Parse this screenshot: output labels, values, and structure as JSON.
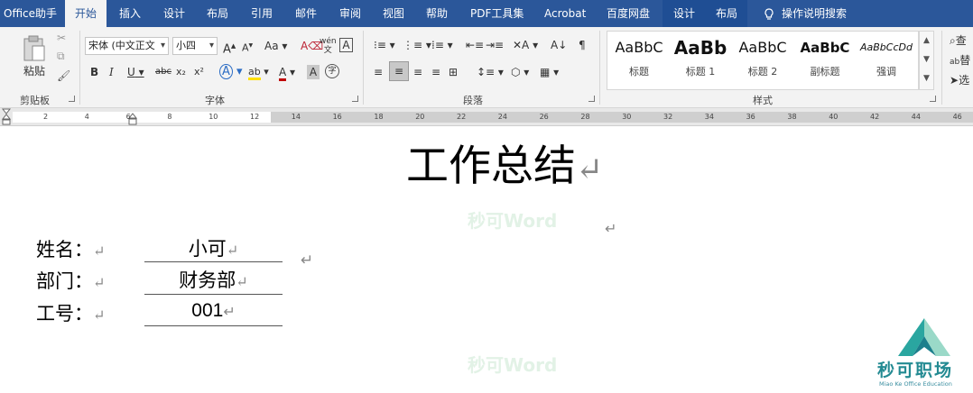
{
  "tabs": [
    {
      "label": "Office助手",
      "active": false
    },
    {
      "label": "开始",
      "active": true
    },
    {
      "label": "插入",
      "active": false
    },
    {
      "label": "设计",
      "active": false
    },
    {
      "label": "布局",
      "active": false
    },
    {
      "label": "引用",
      "active": false
    },
    {
      "label": "邮件",
      "active": false
    },
    {
      "label": "审阅",
      "active": false
    },
    {
      "label": "视图",
      "active": false
    },
    {
      "label": "帮助",
      "active": false
    },
    {
      "label": "PDF工具集",
      "active": false
    },
    {
      "label": "Acrobat",
      "active": false
    },
    {
      "label": "百度网盘",
      "active": false
    },
    {
      "label": "设计",
      "active": false
    },
    {
      "label": "布局",
      "active": false
    }
  ],
  "tell_me": {
    "label": "操作说明搜索",
    "icon": "lightbulb-icon"
  },
  "clipboard": {
    "paste_label": "粘贴",
    "group_label": "剪贴板"
  },
  "font": {
    "name": "宋体 (中文正文",
    "size": "小四",
    "group_label": "字体",
    "bold": "B",
    "italic": "I",
    "underline": "U",
    "strike": "abc",
    "subscript": "x₂",
    "superscript": "x²",
    "grow": "A",
    "shrink": "A",
    "change_case": "Aa",
    "clear": "A",
    "pinyin": "wén",
    "border": "A",
    "effects": "A",
    "highlight": "ab",
    "color": "A",
    "shading": "A",
    "enclose": "字"
  },
  "paragraph": {
    "group_label": "段落"
  },
  "styles": {
    "group_label": "样式",
    "items": [
      {
        "preview": "AaBbC",
        "name": "标题"
      },
      {
        "preview": "AaBb",
        "name": "标题 1"
      },
      {
        "preview": "AaBbC",
        "name": "标题 2"
      },
      {
        "preview": "AaBbC",
        "name": "副标题"
      },
      {
        "preview": "AaBbCcDd",
        "name": "强调"
      }
    ]
  },
  "editing": {
    "find_label": "查",
    "replace_label": "替",
    "select_label": "选"
  },
  "ruler": {
    "numbers": [
      "2",
      "4",
      "6",
      "8",
      "10",
      "12",
      "14",
      "16",
      "18",
      "20",
      "22",
      "24",
      "26",
      "28",
      "30",
      "32",
      "34",
      "36",
      "38",
      "40",
      "42",
      "44",
      "46"
    ]
  },
  "document": {
    "title": "工作总结",
    "para_mark": "↵",
    "fields": [
      {
        "label": "姓名：",
        "value": "小可"
      },
      {
        "label": "部门：",
        "value": "财务部"
      },
      {
        "label": "工号：",
        "value": "001"
      }
    ],
    "watermark": "秒可Word"
  },
  "brand": {
    "name": "秒可职场",
    "sub": "Miao Ke Office Education"
  },
  "colors": {
    "accent": "#2b579a",
    "brand_teal": "#2aa6a0",
    "brand_pale": "#9ad9c8"
  }
}
